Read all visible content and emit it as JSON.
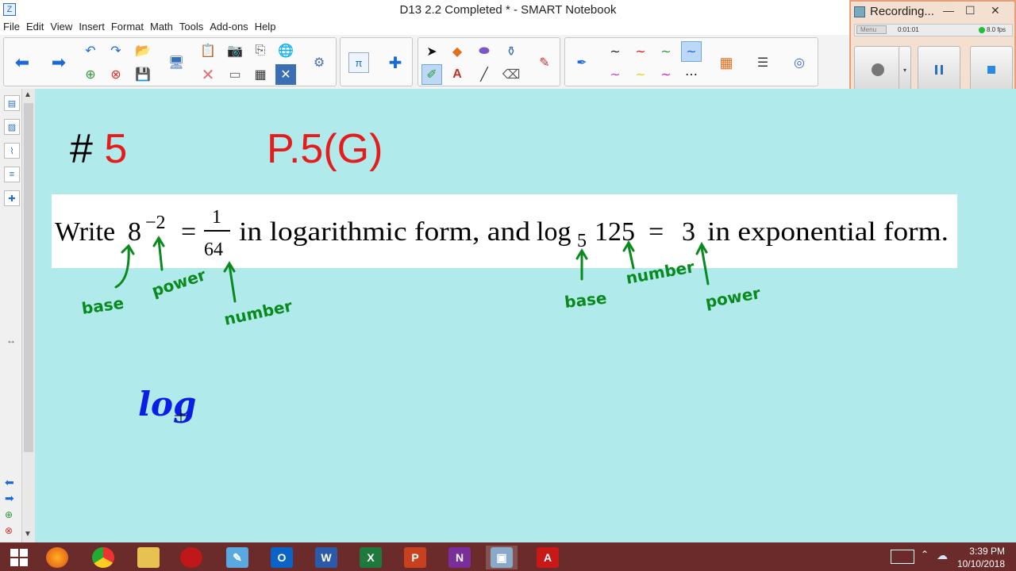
{
  "window": {
    "title": "D13 2.2 Completed * - SMART Notebook"
  },
  "menu": [
    "File",
    "Edit",
    "View",
    "Insert",
    "Format",
    "Math",
    "Tools",
    "Add-ons",
    "Help"
  ],
  "recorder": {
    "title": "Recording...",
    "mode": "Menu",
    "elapsed": "0:01:01",
    "fps": "8.0 fps"
  },
  "page": {
    "problem_hash": "#",
    "problem_number": "5",
    "standard": "P.5(G)",
    "statement": {
      "write": "Write",
      "base1": "8",
      "exp1": "−2",
      "eq1": "=",
      "frac_num": "1",
      "frac_den": "64",
      "mid": "in logarithmic form, and",
      "log": "log",
      "log_base": "5",
      "arg": "125",
      "eq2": "=",
      "val": "3",
      "end": "in exponential form."
    },
    "annotations": {
      "base1": "base",
      "power1": "power",
      "number1": "number",
      "base2": "base",
      "number2": "number",
      "power2": "power",
      "handwriting": "log"
    },
    "colors": {
      "annotation": "#0a8a1e",
      "ink": "#0b1ee6",
      "accent": "#e41c1c",
      "canvas": "#b0eaeb"
    }
  },
  "taskbar": {
    "time": "3:39 PM",
    "date": "10/10/2018",
    "apps": [
      "start-icon",
      "firefox-icon",
      "chrome-icon",
      "file-explorer-icon",
      "app-icon",
      "notebook-icon",
      "outlook-icon",
      "word-icon",
      "excel-icon",
      "powerpoint-icon",
      "onenote-icon",
      "smart-notebook-icon",
      "acrobat-icon"
    ]
  }
}
